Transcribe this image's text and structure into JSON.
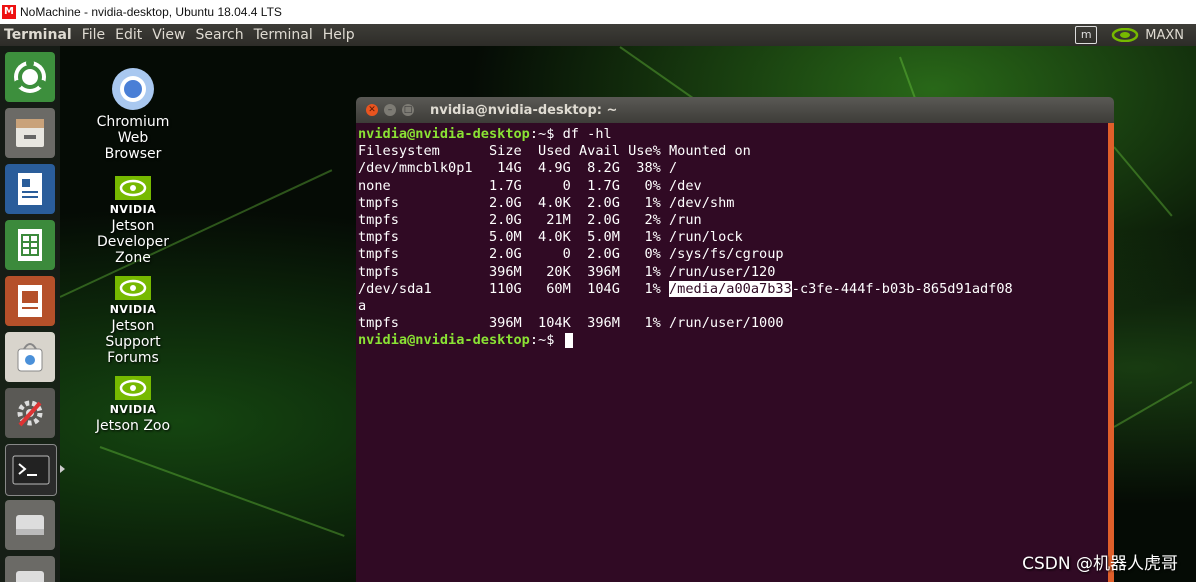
{
  "window": {
    "title": "NoMachine - nvidia-desktop, Ubuntu 18.04.4 LTS",
    "logo": "M"
  },
  "top_panel": {
    "app_name": "Terminal",
    "menus": [
      "File",
      "Edit",
      "View",
      "Search",
      "Terminal",
      "Help"
    ],
    "indicator_box": "m",
    "power_mode": "MAXN"
  },
  "launcher": {
    "items": [
      "ubuntu-dash-icon",
      "files-icon",
      "writer-icon",
      "calc-icon",
      "impress-icon",
      "software-center-icon",
      "settings-icon",
      "terminal-icon",
      "drive-icon",
      "drive-icon"
    ],
    "active_index": 7
  },
  "desktop_icons": [
    {
      "lines": [
        "Chromium",
        "Web",
        "Browser"
      ],
      "icon": "chromium-icon"
    },
    {
      "brand": "NVIDIA",
      "lines": [
        "Jetson",
        "Developer",
        "Zone"
      ],
      "icon": "nvidia-icon"
    },
    {
      "brand": "NVIDIA",
      "lines": [
        "Jetson",
        "Support",
        "Forums"
      ],
      "icon": "nvidia-icon"
    },
    {
      "brand": "NVIDIA",
      "lines": [
        "Jetson Zoo"
      ],
      "icon": "nvidia-icon"
    }
  ],
  "terminal": {
    "title": "nvidia@nvidia-desktop: ~",
    "prompt": "nvidia@nvidia-desktop",
    "prompt_suffix": ":~$ ",
    "command": "df -hl",
    "header": "Filesystem      Size  Used Avail Use% Mounted on",
    "rows": [
      "/dev/mmcblk0p1   14G  4.9G  8.2G  38% /",
      "none            1.7G     0  1.7G   0% /dev",
      "tmpfs           2.0G  4.0K  2.0G   1% /dev/shm",
      "tmpfs           2.0G   21M  2.0G   2% /run",
      "tmpfs           5.0M  4.0K  5.0M   1% /run/lock",
      "tmpfs           2.0G     0  2.0G   0% /sys/fs/cgroup",
      "tmpfs           396M   20K  396M   1% /run/user/120"
    ],
    "sda_row_prefix": "/dev/sda1       110G   60M  104G   1% ",
    "sda_selected": "/media/a00a7b33",
    "sda_rest": "-c3fe-444f-b03b-865d91adf08",
    "sda_wrap": "a",
    "last_row": "tmpfs           396M  104K  396M   1% /run/user/1000"
  },
  "watermark": "CSDN @机器人虎哥",
  "colors": {
    "terminal_bg": "#300a24",
    "prompt_green": "#8ae234",
    "scrollbar": "#e05f2a",
    "nvidia_green": "#76b900"
  }
}
